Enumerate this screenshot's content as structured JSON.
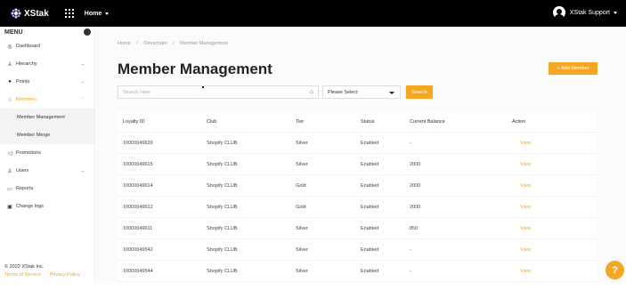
{
  "topbar": {
    "brand": "XStak",
    "home_menu": "Home",
    "user_name": "XStak Support"
  },
  "sidebar": {
    "menu_title": "MENU",
    "items": [
      {
        "label": "Dashboard",
        "icon": "dashboard-icon",
        "glyph": "◎"
      },
      {
        "label": "Hierarchy",
        "icon": "hierarchy-icon",
        "glyph": "⅄",
        "chevron": "⌄"
      },
      {
        "label": "Points",
        "icon": "points-icon",
        "glyph": "●",
        "chevron": "⌄"
      },
      {
        "label": "Members",
        "icon": "members-icon",
        "glyph": "♙",
        "chevron": "⌃"
      }
    ],
    "sub_items": [
      "Member Management",
      "Member Merge"
    ],
    "items_after": [
      {
        "label": "Promotions",
        "icon": "promotions-icon",
        "glyph": "◁"
      },
      {
        "label": "Users",
        "icon": "users-icon",
        "glyph": "♙",
        "chevron": "⌄"
      },
      {
        "label": "Reports",
        "icon": "reports-icon",
        "glyph": "▭"
      },
      {
        "label": "Change logs",
        "icon": "changelogs-icon",
        "glyph": "▣"
      }
    ],
    "footer": {
      "copyright": "© 2022 XStak Inc.",
      "terms": "Terms of Service",
      "privacy": "Privacy Policy"
    }
  },
  "main": {
    "breadcrumb": [
      "Home",
      "/",
      "Omnichain",
      "/",
      "Member Management"
    ],
    "title": "Member Management",
    "add_button": "+ Add Member",
    "search_placeholder": "Search Here",
    "select_value": "Please Select",
    "search_button": "Search",
    "table": {
      "headers": [
        "Loyalty ID",
        "Club",
        "Tier",
        "Status",
        "Current Balance",
        "Action"
      ],
      "rows": [
        [
          "10000049639",
          "Shopify CLUB",
          "Silver",
          "Enabled",
          "-",
          "View"
        ],
        [
          "10000049615",
          "Shopify CLUB",
          "Silver",
          "Enabled",
          "2000",
          "View"
        ],
        [
          "10000049614",
          "Shopify CLUB",
          "Gold",
          "Enabled",
          "2000",
          "View"
        ],
        [
          "10000049612",
          "Shopify CLUB",
          "Gold",
          "Enabled",
          "2000",
          "View"
        ],
        [
          "10000049611",
          "Shopify CLUB",
          "Silver",
          "Enabled",
          "850",
          "View"
        ],
        [
          "10000049542",
          "Shopify CLUB",
          "Silver",
          "Enabled",
          "-",
          "View"
        ],
        [
          "10000049544",
          "Shopify CLUB",
          "Silver",
          "Enabled",
          "-",
          "View"
        ]
      ]
    }
  },
  "help": "?",
  "colors": {
    "accent": "#f5a623",
    "topbar": "#000000"
  }
}
